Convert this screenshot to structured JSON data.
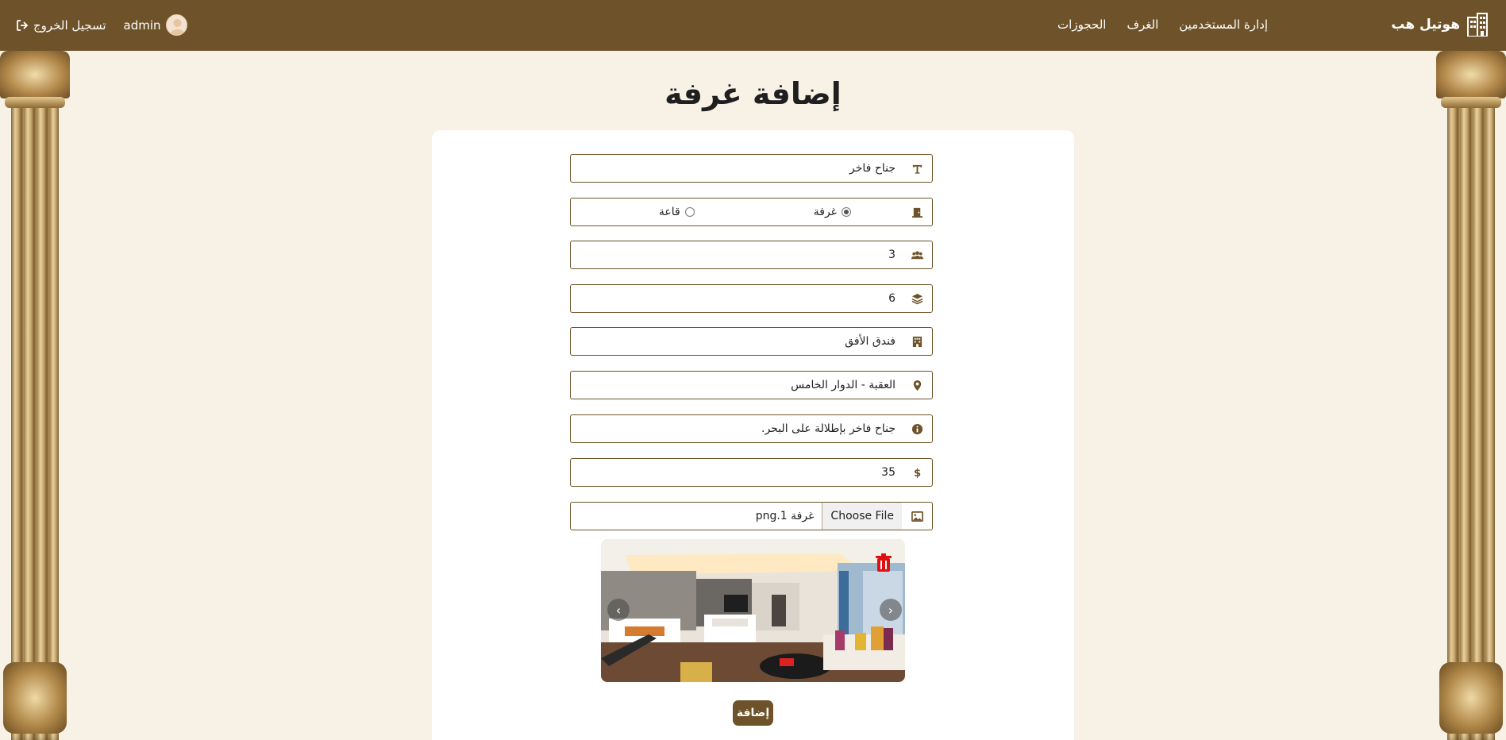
{
  "navbar": {
    "brand": "هوتيل هب",
    "links": [
      "إدارة المستخدمين",
      "الغرف",
      "الحجوزات"
    ],
    "username": "admin",
    "logout": "تسجيل الخروج"
  },
  "page": {
    "title": "إضافة غرفة"
  },
  "form": {
    "name": "جناح فاخر",
    "type_room_label": "غرفة",
    "type_hall_label": "قاعة",
    "type_selected": "غرفة",
    "capacity": "3",
    "floor": "6",
    "hotel": "فندق الأفق",
    "location": "العقبة - الدوار الخامس",
    "description": "جناح فاخر بإطلالة على البحر.",
    "price": "35",
    "file_button": "Choose File",
    "file_name": "غرفة 1.png"
  },
  "submit_label": "إضافة",
  "colors": {
    "brand": "#6e532a",
    "background": "#f8f1e6",
    "delete": "#e01010"
  },
  "icons": [
    "building-icon",
    "text-icon",
    "door-icon",
    "users-icon",
    "layers-icon",
    "hotel-icon",
    "map-pin-icon",
    "info-icon",
    "dollar-icon",
    "image-icon",
    "logout-icon",
    "trash-icon"
  ]
}
